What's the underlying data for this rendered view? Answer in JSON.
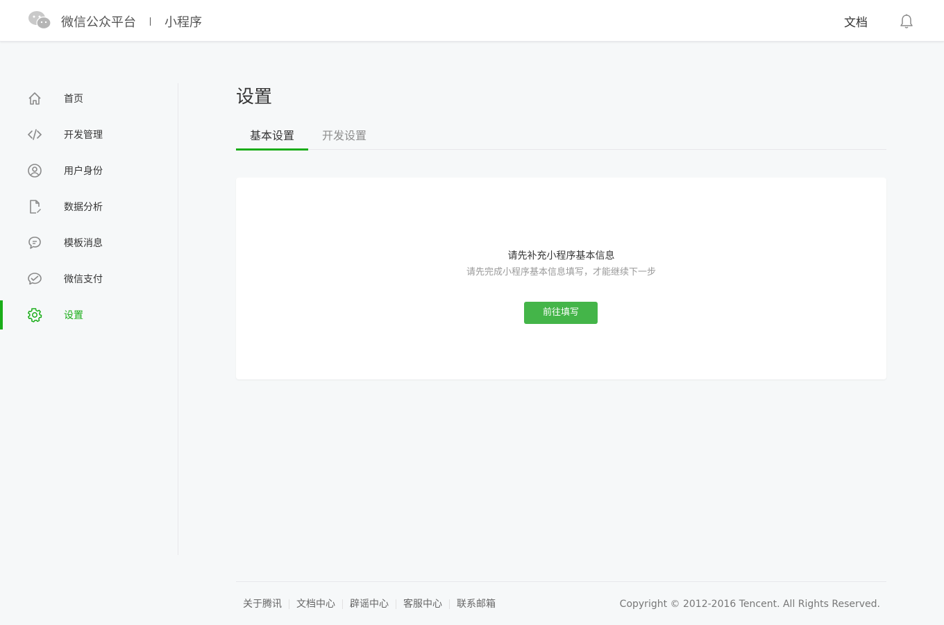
{
  "header": {
    "brand_name": "微信公众平台",
    "product_name": "小程序",
    "doc_link": "文档"
  },
  "sidebar": {
    "items": [
      {
        "label": "首页",
        "icon": "home-icon"
      },
      {
        "label": "开发管理",
        "icon": "code-icon"
      },
      {
        "label": "用户身份",
        "icon": "user-icon"
      },
      {
        "label": "数据分析",
        "icon": "document-chart-icon"
      },
      {
        "label": "模板消息",
        "icon": "message-icon"
      },
      {
        "label": "微信支付",
        "icon": "payment-icon"
      },
      {
        "label": "设置",
        "icon": "gear-icon",
        "active": true
      }
    ]
  },
  "main": {
    "title": "设置",
    "tabs": [
      {
        "label": "基本设置",
        "active": true
      },
      {
        "label": "开发设置",
        "active": false
      }
    ],
    "card": {
      "title": "请先补充小程序基本信息",
      "description": "请先完成小程序基本信息填写，才能继续下一步",
      "button_label": "前往填写"
    }
  },
  "footer": {
    "links": [
      "关于腾讯",
      "文档中心",
      "辟谣中心",
      "客服中心",
      "联系邮箱"
    ],
    "copyright": "Copyright © 2012-2016 Tencent. All Rights Reserved."
  },
  "colors": {
    "accent": "#1aad19",
    "button": "#44b549",
    "background": "#f6f8f9"
  }
}
